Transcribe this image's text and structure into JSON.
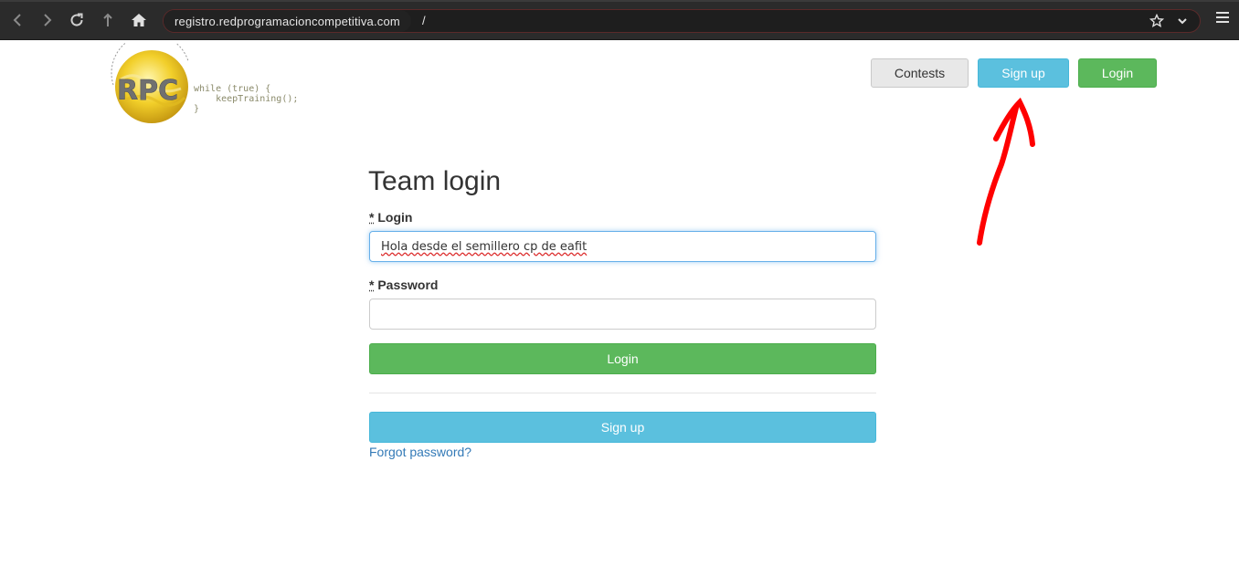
{
  "browser": {
    "url_host": "registro.redprogramacioncompetitiva.com",
    "url_path": "/",
    "icons": [
      "back-icon",
      "forward-icon",
      "reload-icon",
      "up-icon",
      "home-icon",
      "star-icon",
      "chevron-down-icon",
      "menu-icon"
    ]
  },
  "logo": {
    "code_lines": "while (true) {\n    keepTraining();\n}"
  },
  "header": {
    "contests_label": "Contests",
    "signup_label": "Sign up",
    "login_label": "Login"
  },
  "form": {
    "title": "Team login",
    "login_required": "*",
    "login_label": "Login",
    "login_value": "Hola desde el semillero cp de eafit",
    "password_required": "*",
    "password_label": "Password",
    "password_value": "",
    "submit_label": "Login",
    "signup_label": "Sign up",
    "forgot_label": "Forgot password?"
  },
  "colors": {
    "success": "#5cb85c",
    "info": "#5bc0de",
    "link": "#337ab7",
    "annotation": "#ff0000"
  }
}
